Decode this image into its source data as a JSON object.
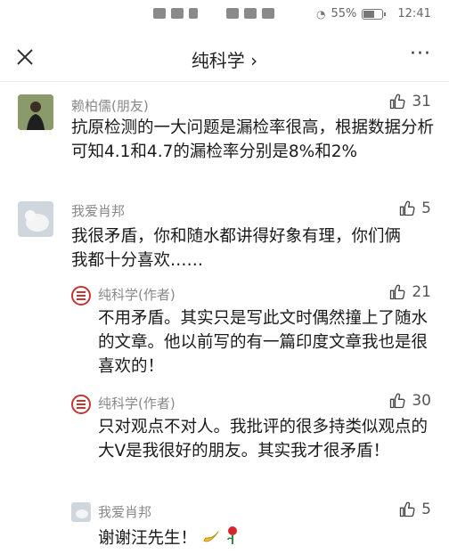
{
  "status_bar": {
    "battery": "55%",
    "time": "12:41"
  },
  "nav": {
    "title": "纯科学 ›",
    "more": "···"
  },
  "comments": [
    {
      "author": "赖柏儒(朋友)",
      "likes": "31",
      "text": "抗原检测的一大问题是漏检率很高，根据数据分析可知4.1和4.7的漏检率分别是8%和2%"
    },
    {
      "author": "我爱肖邦",
      "likes": "5",
      "text": "我很矛盾，你和随水都讲得好象有理，你们俩我都十分喜欢……"
    },
    {
      "author": "纯科学(作者)",
      "likes": "21",
      "text": "不用矛盾。其实只是写此文时偶然撞上了随水的文章。他以前写的有一篇印度文章我也是很喜欢的！"
    },
    {
      "author": "纯科学(作者)",
      "likes": "30",
      "text": "只对观点不对人。我批评的很多持类似观点的大V是我很好的朋友。其实我才很矛盾！"
    },
    {
      "author": "我爱肖邦",
      "likes": "5",
      "text": "谢谢汪先生！"
    }
  ],
  "icons": {
    "close": "close-icon",
    "more": "more-icon",
    "like": "thumbs-up-icon",
    "banana": "banana-icon",
    "rose": "rose-icon"
  }
}
